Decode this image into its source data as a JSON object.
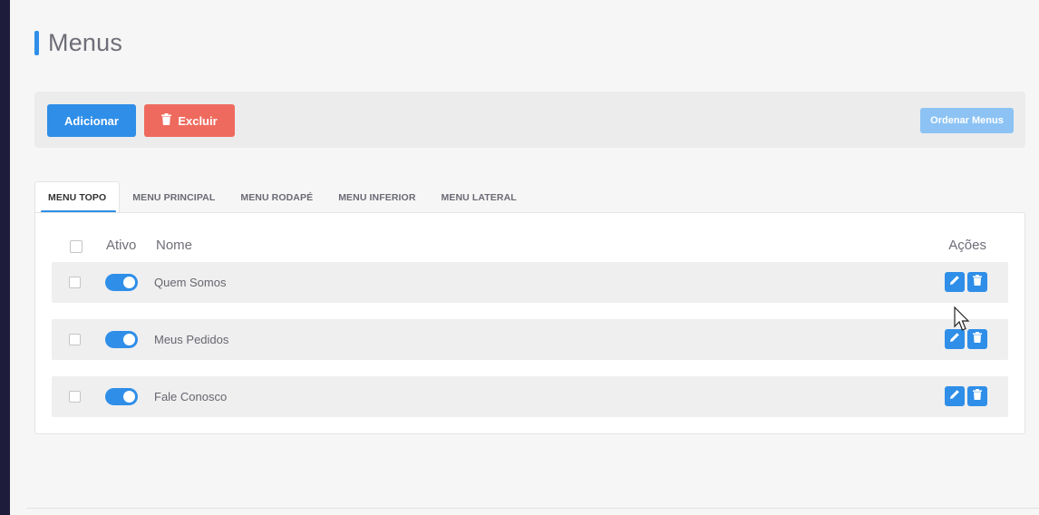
{
  "page": {
    "title": "Menus"
  },
  "toolbar": {
    "add_label": "Adicionar",
    "delete_label": "Excluir",
    "order_label": "Ordenar Menus"
  },
  "tabs": [
    {
      "label": "MENU TOPO",
      "active": true
    },
    {
      "label": "MENU PRINCIPAL",
      "active": false
    },
    {
      "label": "MENU RODAPÉ",
      "active": false
    },
    {
      "label": "MENU INFERIOR",
      "active": false
    },
    {
      "label": "MENU LATERAL",
      "active": false
    }
  ],
  "table": {
    "headers": {
      "active": "Ativo",
      "name": "Nome",
      "actions": "Ações"
    },
    "rows": [
      {
        "name": "Quem Somos",
        "active": true
      },
      {
        "name": "Meus Pedidos",
        "active": true
      },
      {
        "name": "Fale Conosco",
        "active": true
      }
    ]
  },
  "colors": {
    "primary": "#2f8ee8",
    "danger": "#ef6a5e",
    "primary_light": "#8cc3f4",
    "sidebar": "#1e1c3b"
  },
  "icons": {
    "delete_button": "trash-icon",
    "edit_action": "pencil-icon",
    "delete_action": "trash-icon"
  }
}
